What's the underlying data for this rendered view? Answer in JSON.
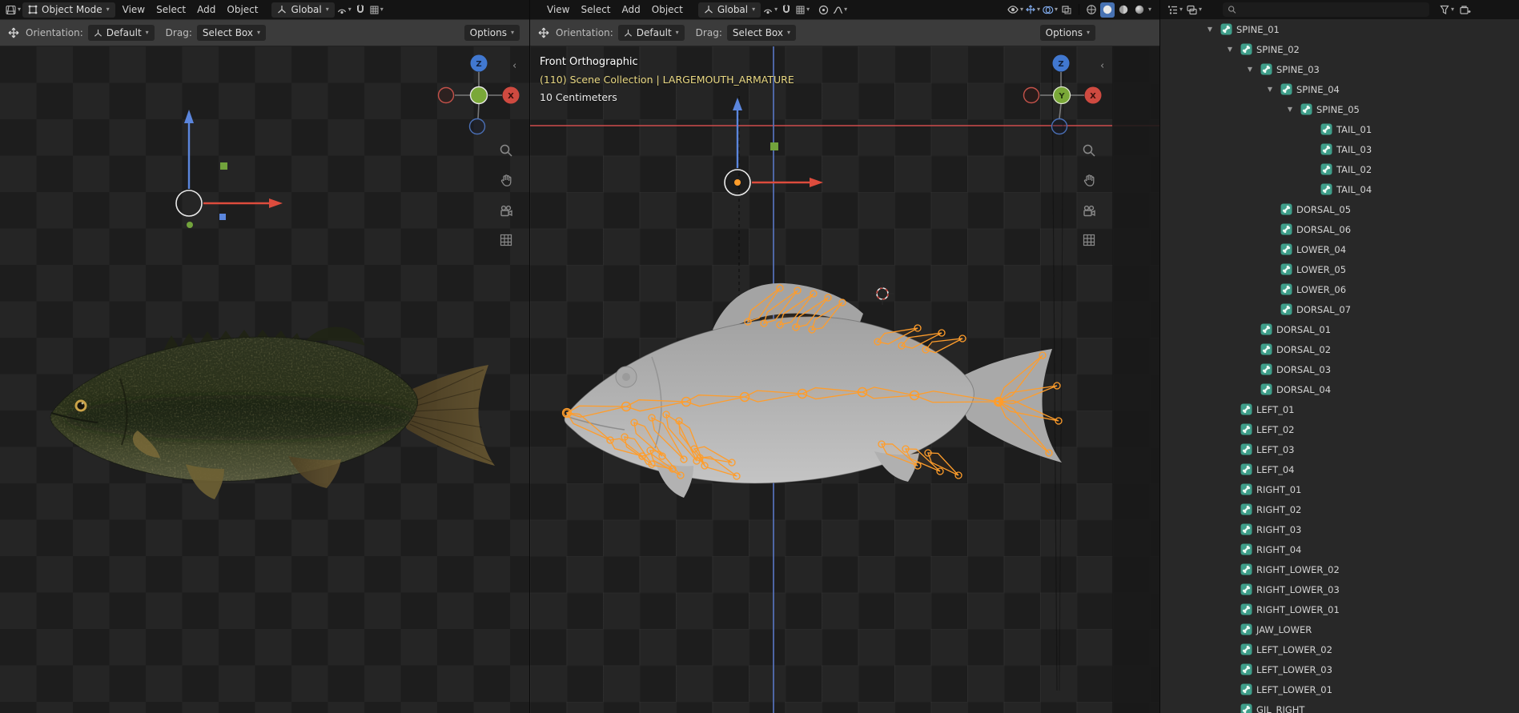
{
  "colors": {
    "accent_blue": "#4772b3",
    "bone_orange": "#ff9d2b",
    "axis_x_red": "#e0433f",
    "axis_y_green": "#72a33c",
    "axis_z_blue": "#3e6fd9",
    "bone_icon_teal": "#3f9e8a",
    "overlay_yellow": "#ead983"
  },
  "viewport_left": {
    "mode": "Object Mode",
    "menus": [
      "View",
      "Select",
      "Add",
      "Object"
    ],
    "transform_orientation": "Global",
    "tool_row": {
      "orientation_label": "Orientation:",
      "orientation_value": "Default",
      "drag_label": "Drag:",
      "drag_value": "Select Box",
      "options_label": "Options"
    }
  },
  "viewport_front": {
    "menus": [
      "View",
      "Select",
      "Add",
      "Object"
    ],
    "transform_orientation": "Global",
    "tool_row": {
      "orientation_label": "Orientation:",
      "orientation_value": "Default",
      "drag_label": "Drag:",
      "drag_value": "Select Box",
      "options_label": "Options"
    },
    "overlay": {
      "view_label": "Front Orthographic",
      "collection_label": "(110) Scene Collection | LARGEMOUTH_ARMATURE",
      "grid_scale_label": "10 Centimeters"
    }
  },
  "nav_gizmo": {
    "x_label": "X",
    "y_label": "Y",
    "z_label": "Z"
  },
  "outliner": {
    "search_value": "",
    "search_placeholder": "",
    "items": [
      {
        "label": "SPINE_01",
        "level": 0,
        "expanded": true
      },
      {
        "label": "SPINE_02",
        "level": 1,
        "expanded": true
      },
      {
        "label": "SPINE_03",
        "level": 2,
        "expanded": true
      },
      {
        "label": "SPINE_04",
        "level": 3,
        "expanded": true
      },
      {
        "label": "SPINE_05",
        "level": 4,
        "expanded": true
      },
      {
        "label": "TAIL_01",
        "level": 5,
        "expanded": false
      },
      {
        "label": "TAIL_03",
        "level": 5,
        "expanded": false
      },
      {
        "label": "TAIL_02",
        "level": 5,
        "expanded": false
      },
      {
        "label": "TAIL_04",
        "level": 5,
        "expanded": false
      },
      {
        "label": "DORSAL_05",
        "level": 3,
        "expanded": false
      },
      {
        "label": "DORSAL_06",
        "level": 3,
        "expanded": false
      },
      {
        "label": "LOWER_04",
        "level": 3,
        "expanded": false
      },
      {
        "label": "LOWER_05",
        "level": 3,
        "expanded": false
      },
      {
        "label": "LOWER_06",
        "level": 3,
        "expanded": false
      },
      {
        "label": "DORSAL_07",
        "level": 3,
        "expanded": false
      },
      {
        "label": "DORSAL_01",
        "level": 2,
        "expanded": false
      },
      {
        "label": "DORSAL_02",
        "level": 2,
        "expanded": false
      },
      {
        "label": "DORSAL_03",
        "level": 2,
        "expanded": false
      },
      {
        "label": "DORSAL_04",
        "level": 2,
        "expanded": false
      },
      {
        "label": "LEFT_01",
        "level": 1,
        "expanded": false
      },
      {
        "label": "LEFT_02",
        "level": 1,
        "expanded": false
      },
      {
        "label": "LEFT_03",
        "level": 1,
        "expanded": false
      },
      {
        "label": "LEFT_04",
        "level": 1,
        "expanded": false
      },
      {
        "label": "RIGHT_01",
        "level": 1,
        "expanded": false
      },
      {
        "label": "RIGHT_02",
        "level": 1,
        "expanded": false
      },
      {
        "label": "RIGHT_03",
        "level": 1,
        "expanded": false
      },
      {
        "label": "RIGHT_04",
        "level": 1,
        "expanded": false
      },
      {
        "label": "RIGHT_LOWER_02",
        "level": 1,
        "expanded": false
      },
      {
        "label": "RIGHT_LOWER_03",
        "level": 1,
        "expanded": false
      },
      {
        "label": "RIGHT_LOWER_01",
        "level": 1,
        "expanded": false
      },
      {
        "label": "JAW_LOWER",
        "level": 1,
        "expanded": false
      },
      {
        "label": "LEFT_LOWER_02",
        "level": 1,
        "expanded": false
      },
      {
        "label": "LEFT_LOWER_03",
        "level": 1,
        "expanded": false
      },
      {
        "label": "LEFT_LOWER_01",
        "level": 1,
        "expanded": false
      },
      {
        "label": "GIL_RIGHT",
        "level": 1,
        "expanded": false
      }
    ]
  }
}
